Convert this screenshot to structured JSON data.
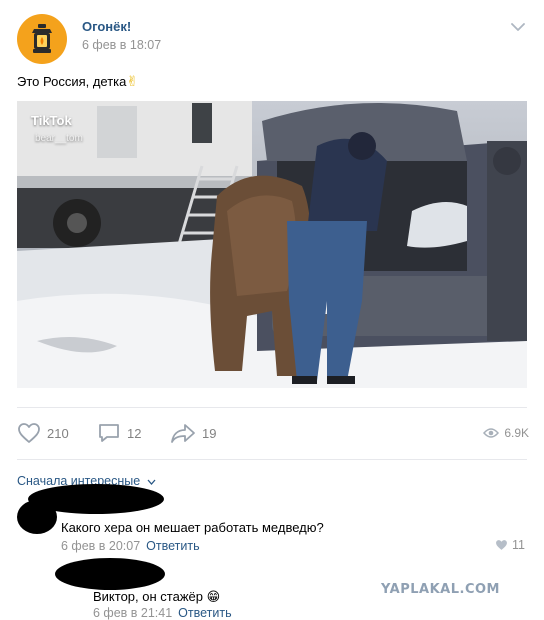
{
  "post": {
    "author": "Огонёк!",
    "date": "6 фев в 18:07",
    "text": "Это Россия, детка",
    "text_emoji": "✌"
  },
  "media": {
    "overlay_brand": "TikTok",
    "overlay_handle": "bear__tom"
  },
  "actions": {
    "likes": "210",
    "comments": "12",
    "shares": "19",
    "views": "6.9K"
  },
  "comments_sort": "Сначала интересные",
  "comments": [
    {
      "text": "Какого хера он мешает работать медведю?",
      "date": "6 фев в 20:07",
      "reply_label": "Ответить",
      "likes": "11"
    },
    {
      "text": "Виктор, он стажёр",
      "emoji": "😁",
      "date": "6 фев в 21:41",
      "reply_label": "Ответить"
    }
  ],
  "watermark": "YAPLAKAL.COM",
  "colors": {
    "link": "#2a5885",
    "meta": "#939393",
    "avatar_bg": "#f4a21c"
  }
}
